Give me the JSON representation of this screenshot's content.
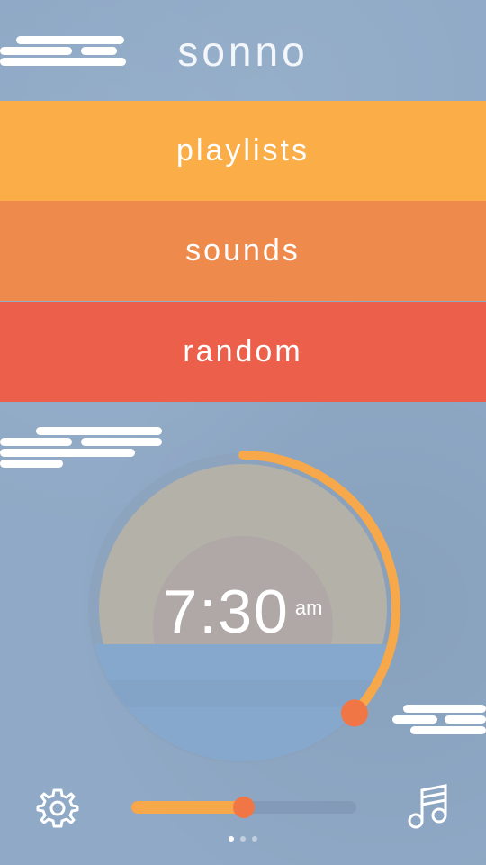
{
  "app": {
    "title": "sonno"
  },
  "menu": {
    "items": [
      {
        "label": "playlists",
        "color": "#fbad47"
      },
      {
        "label": "sounds",
        "color": "#ee8a4b"
      },
      {
        "label": "random",
        "color": "#ec604b"
      }
    ]
  },
  "alarm": {
    "time": "7:30",
    "period": "am",
    "progress": 0.37,
    "arc_color": "#f6a84a",
    "knob_color": "#f07745"
  },
  "volume": {
    "level": 0.5
  },
  "icons": {
    "settings": "gear-icon",
    "music": "music-note-icon"
  },
  "pager": {
    "count": 3,
    "active": 0
  },
  "colors": {
    "background": "#8fa9c6",
    "accent": "#f6a84a"
  }
}
